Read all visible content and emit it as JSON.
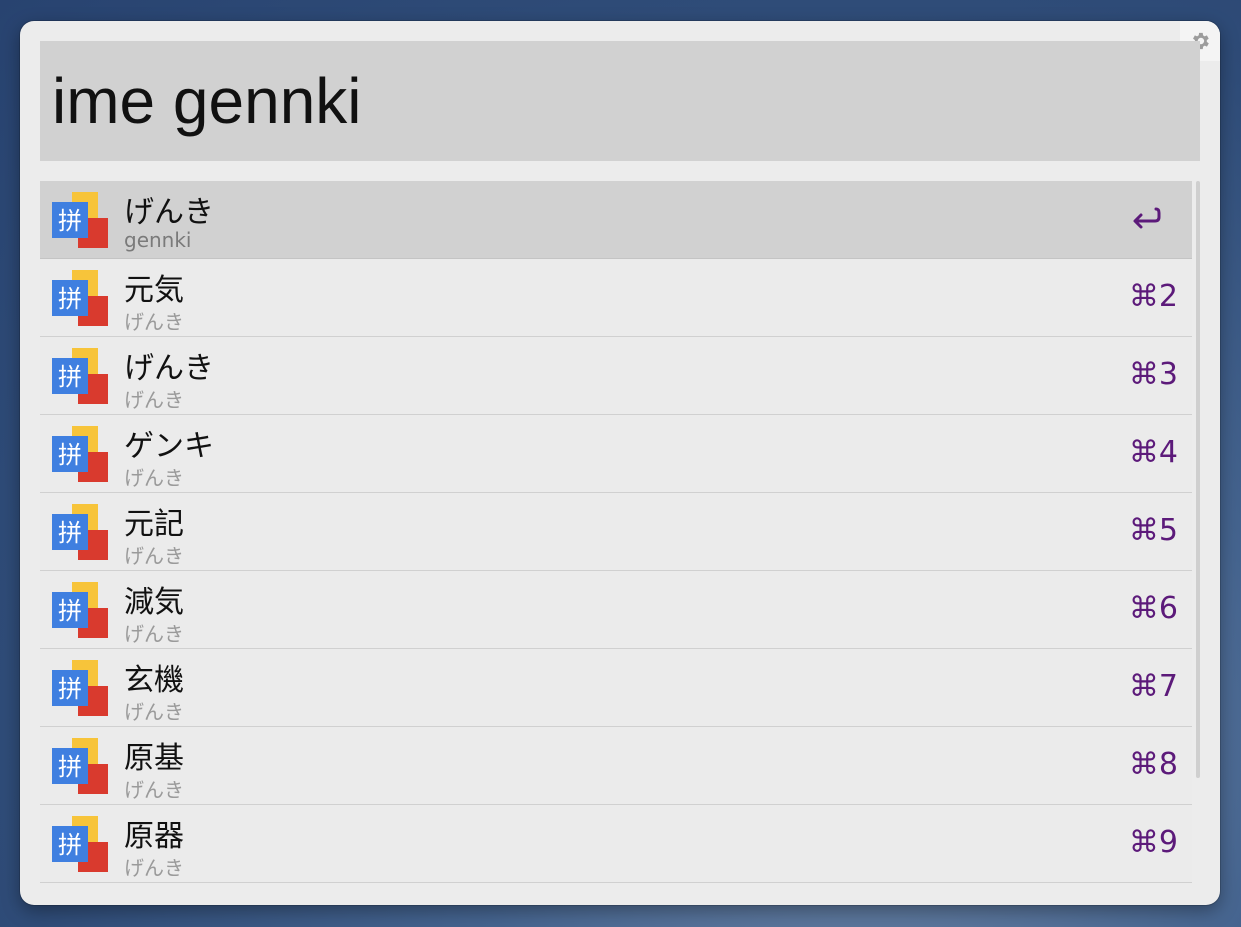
{
  "search": {
    "query": "ime gennki"
  },
  "colors": {
    "accent": "#5c1a7a",
    "selected_row": "#d1d1d1",
    "panel": "#ececec"
  },
  "results": [
    {
      "title": "げんき",
      "subtitle": "gennki",
      "shortcut": "",
      "selected": true,
      "action_icon": "return-icon"
    },
    {
      "title": "元気",
      "subtitle": "げんき",
      "shortcut": "⌘2"
    },
    {
      "title": "げんき",
      "subtitle": "げんき",
      "shortcut": "⌘3"
    },
    {
      "title": "ゲンキ",
      "subtitle": "げんき",
      "shortcut": "⌘4"
    },
    {
      "title": "元記",
      "subtitle": "げんき",
      "shortcut": "⌘5"
    },
    {
      "title": "減気",
      "subtitle": "げんき",
      "shortcut": "⌘6"
    },
    {
      "title": "玄機",
      "subtitle": "げんき",
      "shortcut": "⌘7"
    },
    {
      "title": "原基",
      "subtitle": "げんき",
      "shortcut": "⌘8"
    },
    {
      "title": "原器",
      "subtitle": "げんき",
      "shortcut": "⌘9"
    }
  ],
  "icons": {
    "result": "pinyin-ime-icon",
    "icon_glyph": "拼",
    "settings": "gear-icon"
  }
}
